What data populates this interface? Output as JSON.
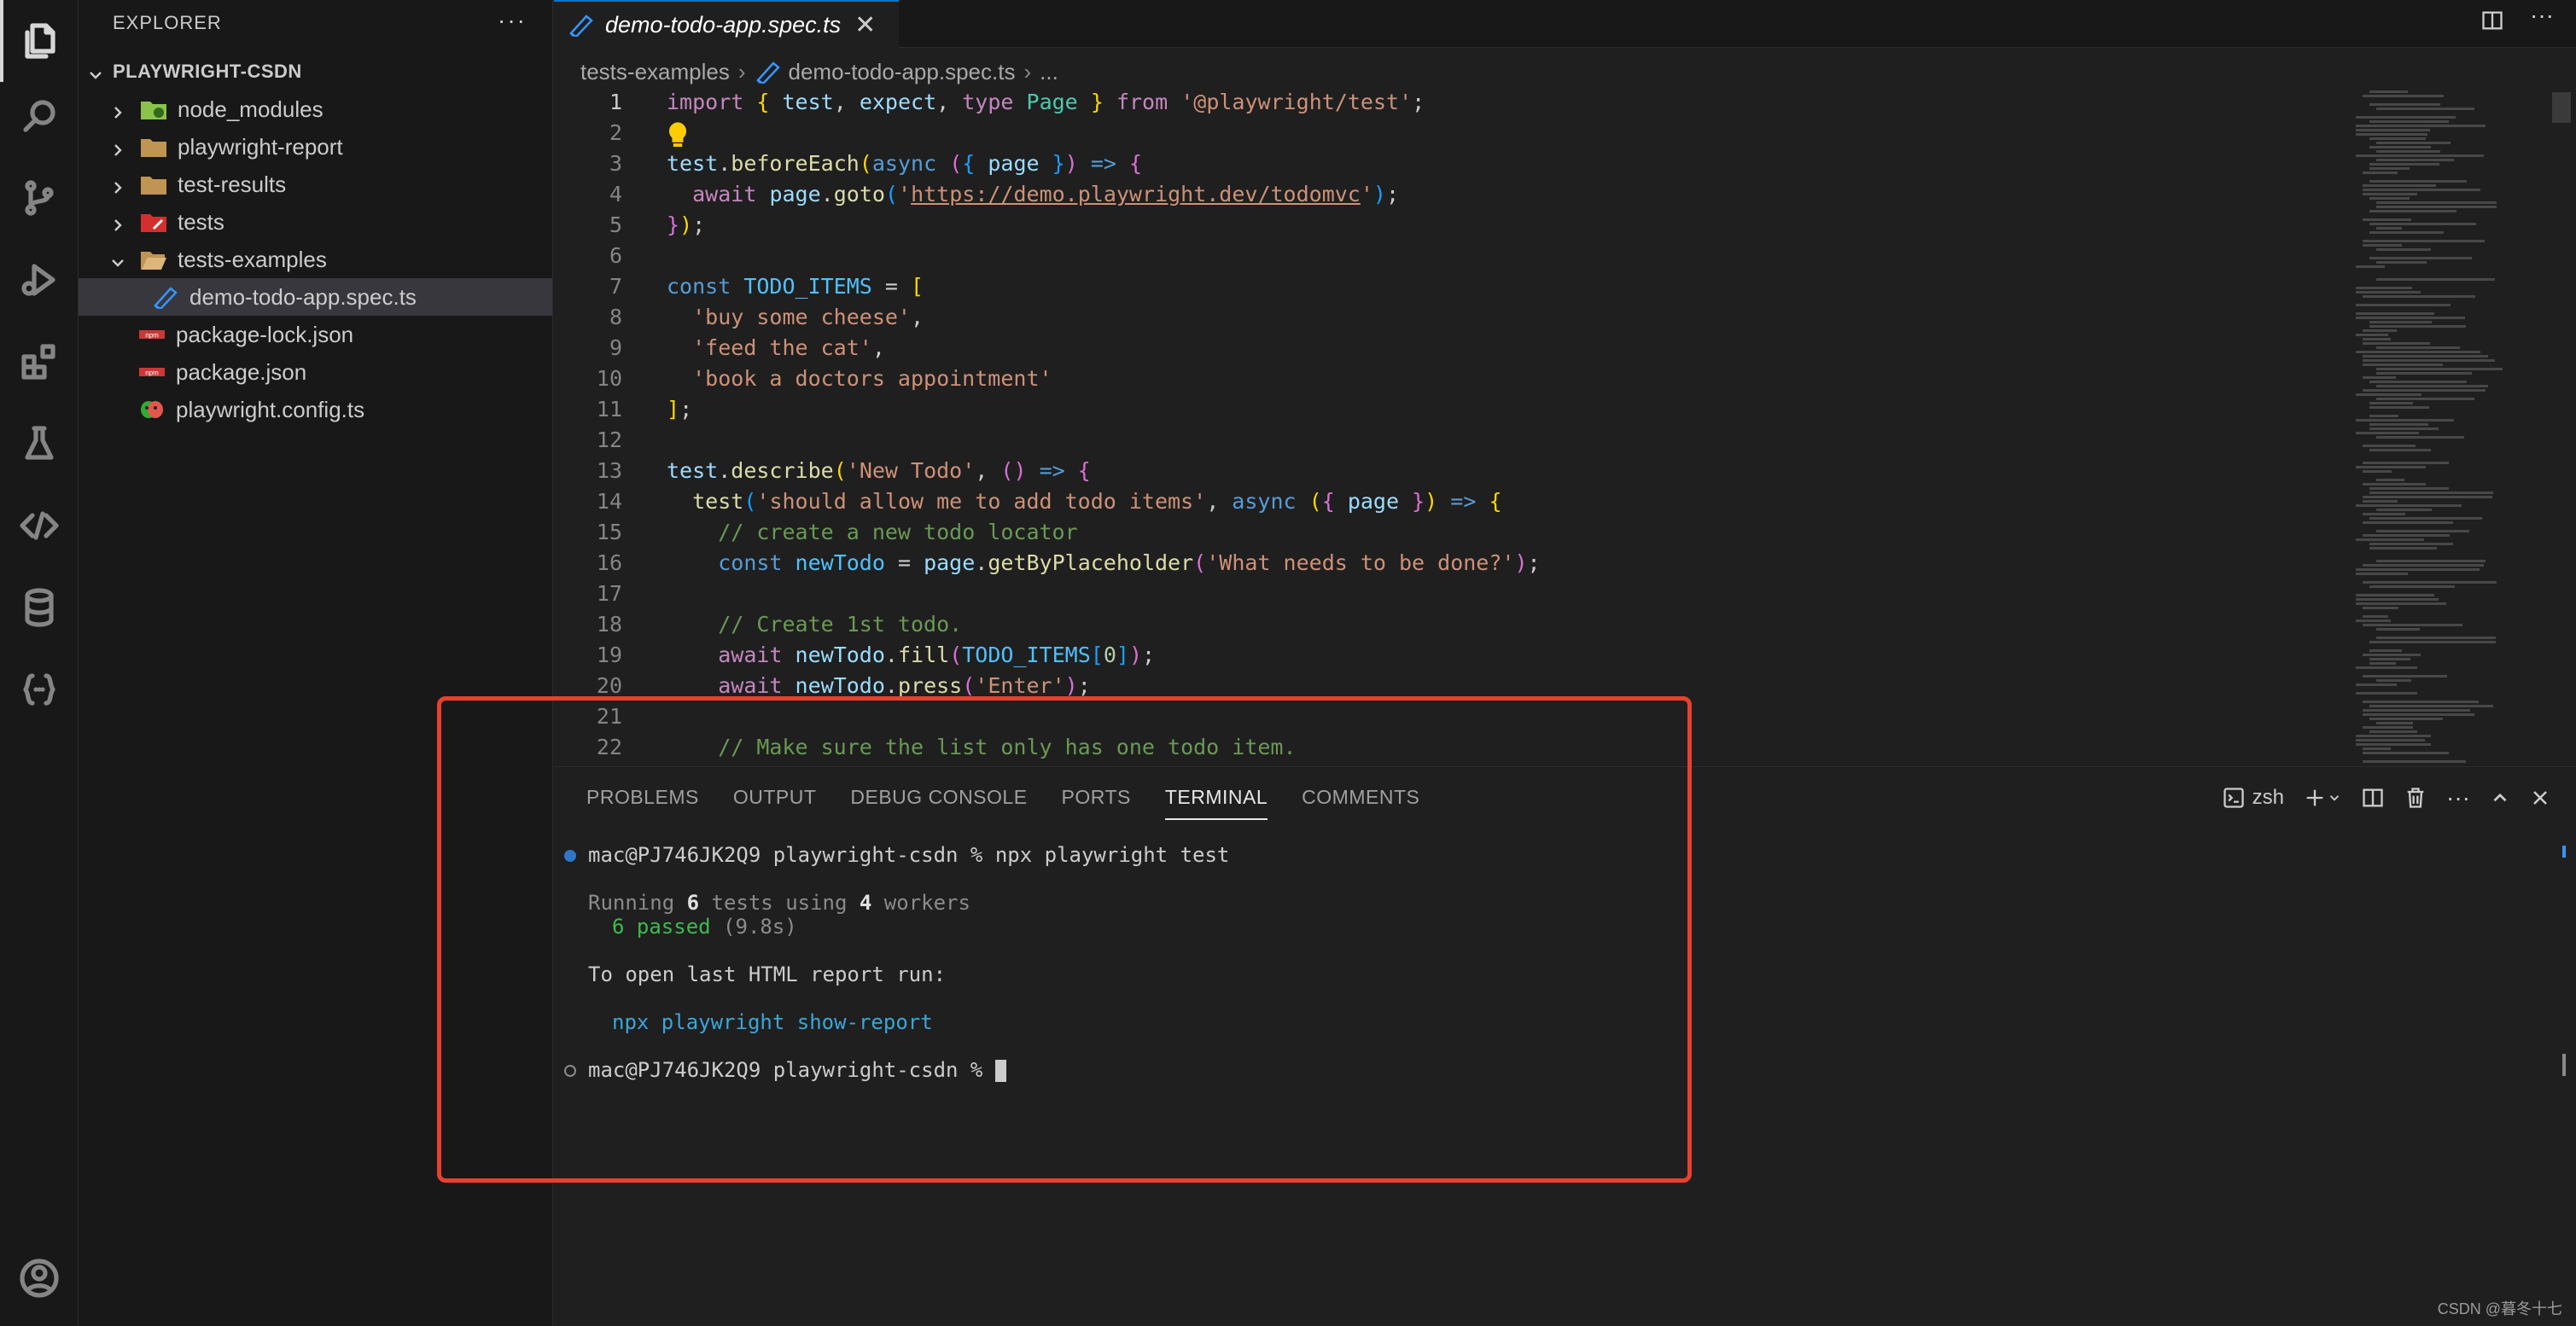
{
  "activity_bar": {
    "icons": [
      "explorer-icon",
      "search-icon",
      "source-control-icon",
      "run-debug-icon",
      "extensions-icon",
      "testing-icon",
      "remote-icon",
      "database-icon",
      "json-icon"
    ],
    "accounts_icon": "account-icon"
  },
  "sidebar": {
    "title": "EXPLORER",
    "more": "···",
    "project": "PLAYWRIGHT-CSDN",
    "items": [
      {
        "label": "node_modules",
        "icon": "folder-node-icon"
      },
      {
        "label": "playwright-report",
        "icon": "folder-icon"
      },
      {
        "label": "test-results",
        "icon": "folder-icon"
      },
      {
        "label": "tests",
        "icon": "folder-test-icon"
      },
      {
        "label": "tests-examples",
        "icon": "folder-open-icon"
      },
      {
        "label": "demo-todo-app.spec.ts",
        "icon": "playwright-file-icon"
      },
      {
        "label": "package-lock.json",
        "icon": "npm-icon"
      },
      {
        "label": "package.json",
        "icon": "npm-icon"
      },
      {
        "label": "playwright.config.ts",
        "icon": "playwright-config-icon"
      }
    ]
  },
  "tab": {
    "label": "demo-todo-app.spec.ts",
    "close": "✕"
  },
  "breadcrumb": {
    "folder": "tests-examples",
    "file": "demo-todo-app.spec.ts",
    "more": "..."
  },
  "editor": {
    "line_numbers": [
      "1",
      "2",
      "3",
      "4",
      "5",
      "6",
      "7",
      "8",
      "9",
      "10",
      "11",
      "12",
      "13",
      "14",
      "15",
      "16",
      "17",
      "18",
      "19",
      "20",
      "21",
      "22"
    ]
  },
  "panel": {
    "tabs": [
      "PROBLEMS",
      "OUTPUT",
      "DEBUG CONSOLE",
      "PORTS",
      "TERMINAL",
      "COMMENTS"
    ],
    "active_tab": "TERMINAL",
    "shell": "zsh"
  },
  "terminal": {
    "prompt": "mac@PJ746JK2Q9 playwright-csdn % ",
    "command": "npx playwright test",
    "running_prefix": "Running ",
    "tests_count": "6",
    "tests_mid": " tests using ",
    "workers_count": "4",
    "workers_suffix": " workers",
    "passed": "6 passed",
    "duration": " (9.8s)",
    "open_report": "To open last HTML report run:",
    "report_cmd": "npx playwright show-report"
  },
  "watermark": "CSDN @暮冬十七",
  "colors": {
    "accent": "#0078d4",
    "highlight_border": "#e8402f",
    "passed": "#3fb950"
  }
}
